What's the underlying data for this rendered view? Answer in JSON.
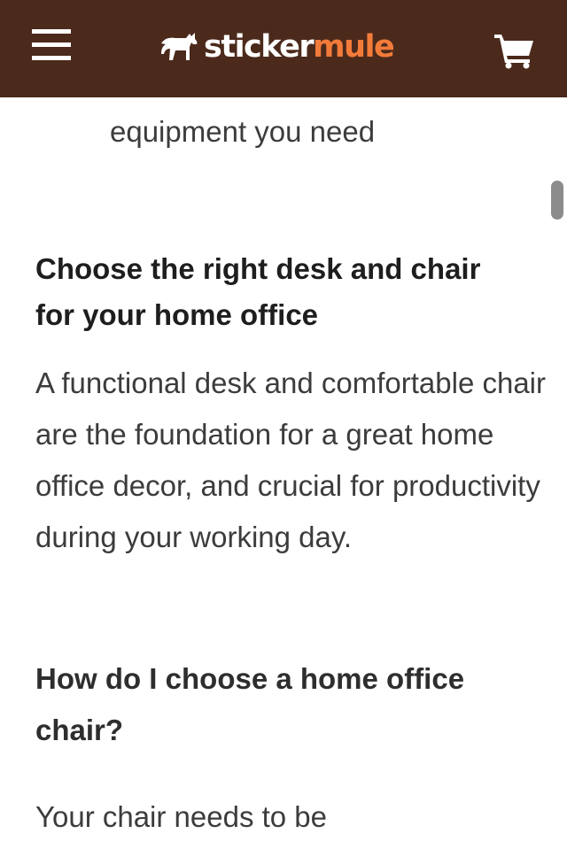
{
  "header": {
    "logo_part1": "sticker",
    "logo_part2": "mule",
    "icons": {
      "menu": "hamburger-menu-icon",
      "logo_mark": "mule-icon",
      "cart": "shopping-cart-icon"
    },
    "colors": {
      "background": "#4b2a1c",
      "accent": "#f37b3a",
      "icon": "#ffffff"
    }
  },
  "article": {
    "list_item_fragment": "books, and any other work equipment you need",
    "heading_desk_chair": "Choose the right desk and chair for your home office",
    "paragraph_desk_chair": "A functional desk and comfortable chair are the foundation for a great home office decor, and crucial for productivity during your working day.",
    "heading_choose_chair": "How do I choose a home office chair?",
    "paragraph_chair_start": "Your chair needs to be"
  }
}
